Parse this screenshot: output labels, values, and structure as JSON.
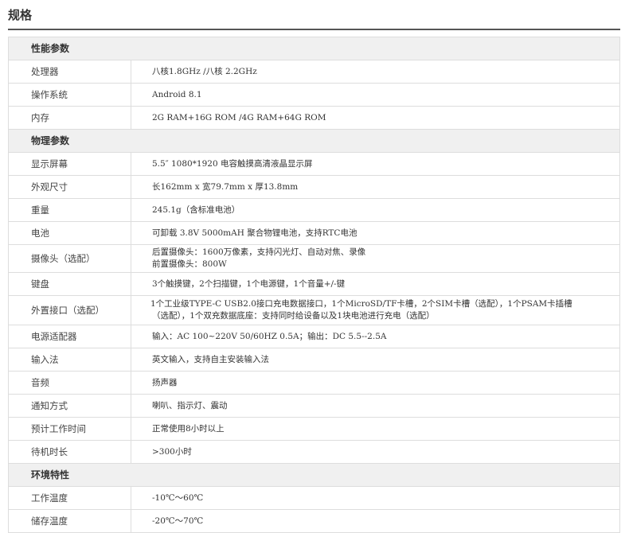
{
  "title": "规格",
  "sections": [
    {
      "heading": "性能参数",
      "rows": [
        {
          "label": "处理器",
          "value": "八核1.8GHz /八核 2.2GHz"
        },
        {
          "label": "操作系统",
          "value": "Android 8.1"
        },
        {
          "label": "内存",
          "value": "2G RAM+16G ROM /4G RAM+64G ROM"
        }
      ]
    },
    {
      "heading": "物理参数",
      "rows": [
        {
          "label": "显示屏幕",
          "value": "5.5″ 1080*1920 电容触摸高清液晶显示屏"
        },
        {
          "label": "外观尺寸",
          "value": "长162mm x 宽79.7mm x 厚13.8mm"
        },
        {
          "label": "重量",
          "value": "245.1g（含标准电池）"
        },
        {
          "label": "电池",
          "value": "可卸载 3.8V 5000mAH 聚合物锂电池，支持RTC电池"
        },
        {
          "label": "摄像头（选配）",
          "value": "后置摄像头：1600万像素，支持闪光灯、自动对焦、录像",
          "value2": "前置摄像头：800W"
        },
        {
          "label": "键盘",
          "value": "3个触摸键，2个扫描键，1个电源键，1个音量+/-键"
        },
        {
          "label": "外置接口（选配）",
          "value": "1个工业级TYPE-C USB2.0接口充电数据接口，1个MicroSD/TF卡槽，2个SIM卡槽（选配），1个PSAM卡插槽",
          "value2": "（选配），1个双充数据底座：支持同时给设备以及1块电池进行充电（选配）"
        },
        {
          "label": "电源适配器",
          "value": "输入：AC 100~220V 50/60HZ 0.5A；输出：DC 5.5--2.5A"
        },
        {
          "label": "输入法",
          "value": "英文输入，支持自主安装输入法"
        },
        {
          "label": "音频",
          "value": "扬声器"
        },
        {
          "label": "通知方式",
          "value": "喇叭、指示灯、震动"
        },
        {
          "label": "预计工作时间",
          "value": "正常使用8小时以上"
        },
        {
          "label": "待机时长",
          "value": ">300小时"
        }
      ]
    },
    {
      "heading": "环境特性",
      "rows": [
        {
          "label": "工作温度",
          "value": "-10℃～60℃"
        },
        {
          "label": "储存温度",
          "value": "-20℃～70℃"
        }
      ]
    }
  ]
}
